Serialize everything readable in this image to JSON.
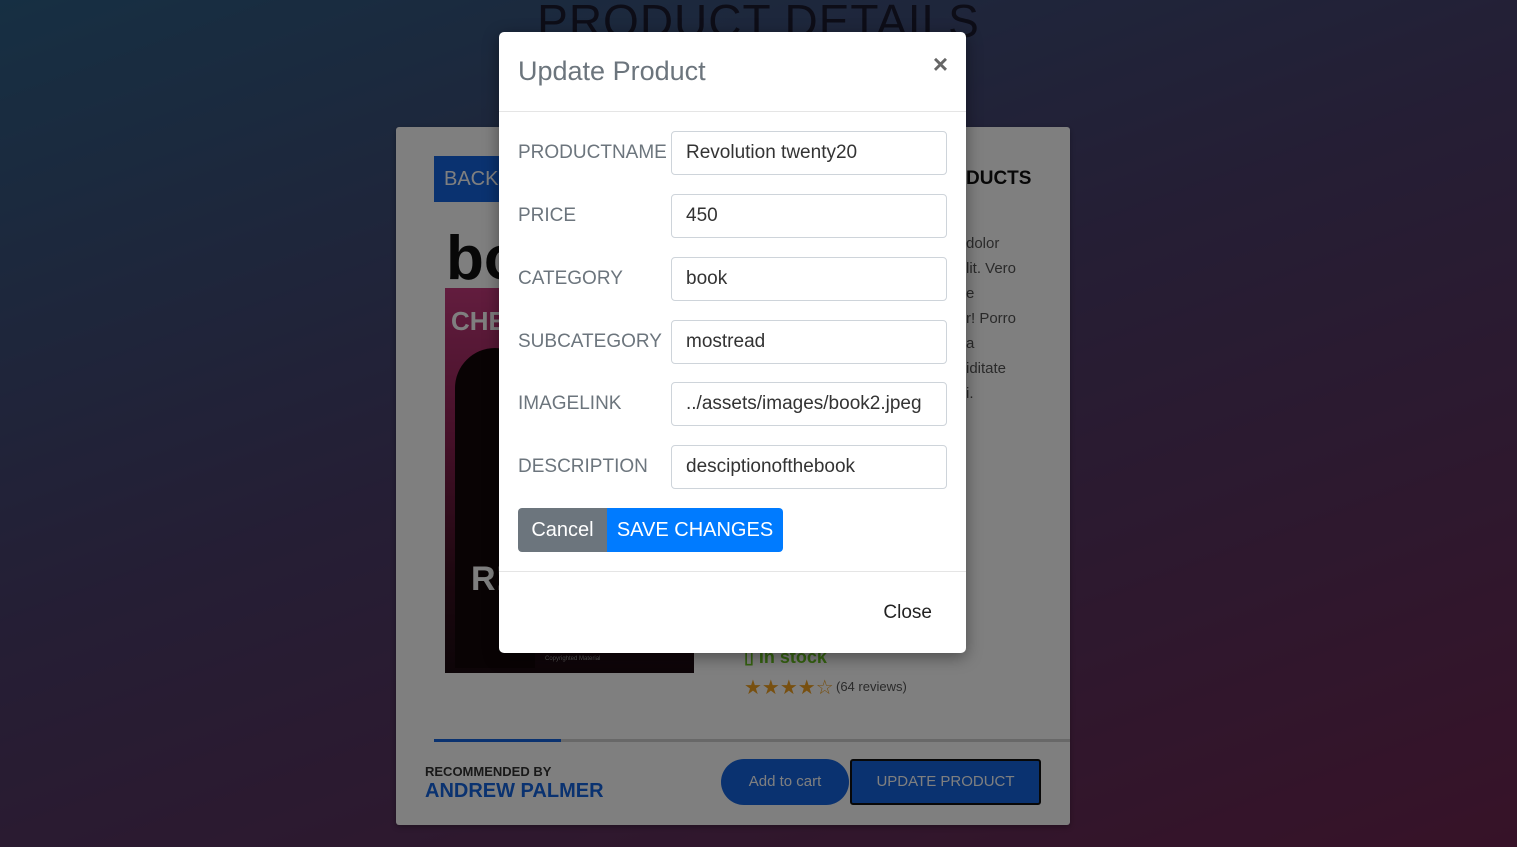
{
  "page": {
    "title": "PRODUCT DETAILS"
  },
  "card": {
    "back_label": "BACK‹",
    "big_word": "bo",
    "cover_top": "CHE",
    "cover_mid": "R!",
    "copyright": "Copyrighted Material",
    "section_title": "DUCTS",
    "description_lines": [
      "dolor",
      "lit. Vero",
      "e",
      "r! Porro",
      "a",
      "iditate",
      "i."
    ],
    "stock": "▯ In stock",
    "stars": "★★★★☆",
    "rating": 4,
    "reviews": "(64 reviews)",
    "progress": 0.2,
    "recommended_label": "RECOMMENDED BY",
    "recommended_name": "ANDREW PALMER",
    "add_to_cart": "Add to cart",
    "update_product": "UPDATE PRODUCT"
  },
  "modal": {
    "title": "Update Product",
    "close_x": "×",
    "fields": [
      {
        "label": "PRODUCTNAME",
        "value": "Revolution twenty20"
      },
      {
        "label": "PRICE",
        "value": "450"
      },
      {
        "label": "CATEGORY",
        "value": "book"
      },
      {
        "label": "SUBCATEGORY",
        "value": "mostread"
      },
      {
        "label": "IMAGELINK",
        "value": "../assets/images/book2.jpeg"
      },
      {
        "label": "DESCRIPTION",
        "value": "desciptionofthebook"
      }
    ],
    "cancel_label": "Cancel",
    "save_label": "SAVE CHANGES",
    "close_label": "Close"
  },
  "colors": {
    "accent": "#1565e0",
    "primary": "#007bff",
    "secondary": "#6c757d",
    "in_stock": "#6bc520"
  }
}
